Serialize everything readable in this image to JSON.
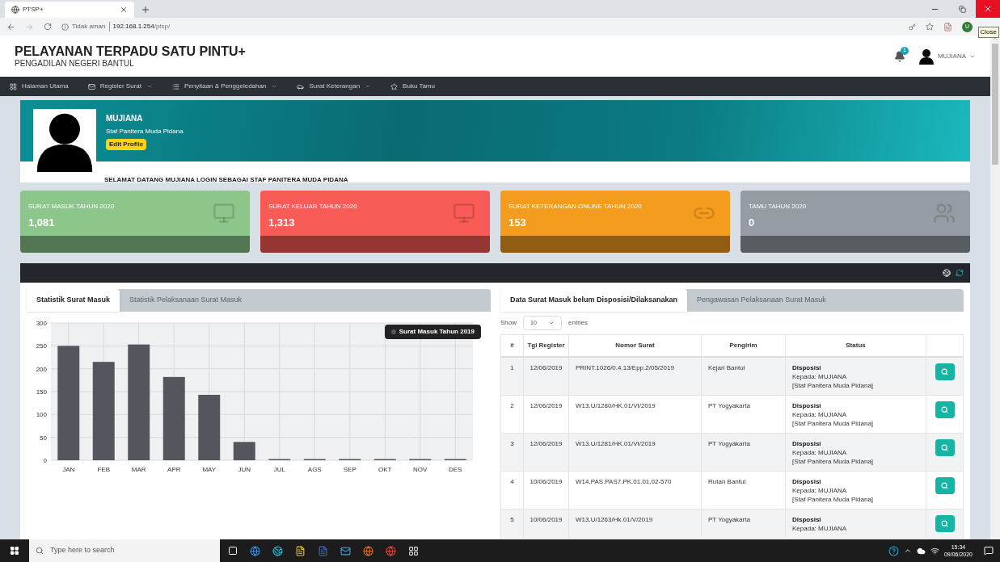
{
  "browser": {
    "tab_title": "PTSP+",
    "security": "Tidak aman",
    "url_host": "192.168.1.254",
    "url_path": "/ptsp/",
    "profile_initial": "U",
    "tooltip": "Close"
  },
  "header": {
    "title": "PELAYANAN TERPADU SATU PINTU+",
    "subtitle": "PENGADILAN NEGERI BANTUL",
    "notification_count": "1",
    "user": "MUJIANA"
  },
  "nav": [
    {
      "label": "Halaman Utama",
      "kind": "grid",
      "dropdown": false
    },
    {
      "label": "Register Surat",
      "kind": "mail",
      "dropdown": true
    },
    {
      "label": "Penyitaan & Penggeledahan",
      "kind": "list",
      "dropdown": true
    },
    {
      "label": "Surat Keterangan",
      "kind": "car",
      "dropdown": true
    },
    {
      "label": "Buku Tamu",
      "kind": "star",
      "dropdown": false
    }
  ],
  "profile": {
    "name": "MUJIANA",
    "role": "Staf Panitera Muda Pidana",
    "edit_button": "Edit Profile",
    "welcome": "SELAMAT DATANG MUJIANA LOGIN SEBAGAI STAF PANITERA MUDA PIDANA"
  },
  "stats": [
    {
      "label": "SURAT MASUK TAHUN 2020",
      "value": "1,081",
      "color": "#8cc68a",
      "kind": "monitor"
    },
    {
      "label": "SURAT KELUAR TAHUN 2020",
      "value": "1,313",
      "color": "#f95b57",
      "kind": "monitor"
    },
    {
      "label": "SURAT KETERANGAN ONLINE TAHUN 2020",
      "value": "153",
      "color": "#f39c1e",
      "kind": "link"
    },
    {
      "label": "TAMU TAHUN 2020",
      "value": "0",
      "color": "#959ca3",
      "kind": "users"
    }
  ],
  "chart_panel": {
    "tabs": [
      {
        "label": "Statistik Surat Masuk",
        "selected": true
      },
      {
        "label": "Statistik Pelaksanaan Surat Masuk",
        "selected": false
      }
    ],
    "chart_data": {
      "type": "bar",
      "categories": [
        "JAN",
        "FEB",
        "MAR",
        "APR",
        "MAY",
        "JUN",
        "JUL",
        "AGS",
        "SEP",
        "OKT",
        "NOV",
        "DES"
      ],
      "series": [
        {
          "name": "Surat Masuk Tahun 2019",
          "color": "#53565c",
          "values": [
            250,
            215,
            253,
            182,
            143,
            40,
            0,
            0,
            0,
            0,
            0,
            0
          ]
        }
      ],
      "grid": true,
      "ylim": [
        0,
        300
      ],
      "yticks": [
        0,
        50,
        100,
        150,
        200,
        250,
        300
      ]
    }
  },
  "table_panel": {
    "tabs": [
      {
        "label": "Data Surat Masuk belum Disposisi/Dilaksanakan",
        "selected": true
      },
      {
        "label": "Pengawasan Pelaksanaan Surat Masuk",
        "selected": false
      }
    ],
    "show_label": "Show",
    "page_size": "10",
    "entries_label": "entries",
    "columns": [
      "#",
      "Tgl Register",
      "Nomor Surat",
      "Pengirim",
      "Status"
    ],
    "rows": [
      {
        "no": "1",
        "date": "12/06/2019",
        "number": "PRINT.1026/0.4.13/Epp.2/05/2019",
        "sender": "Kejari Bantul",
        "status_title": "Disposisi",
        "status_lines": [
          "Kepada: MUJIANA",
          "[Staf Panitera Muda Pidana]"
        ]
      },
      {
        "no": "2",
        "date": "12/06/2019",
        "number": "W13.U/1280/HK.01/VI/2019",
        "sender": "PT Yogyakarta",
        "status_title": "Disposisi",
        "status_lines": [
          "Kepada: MUJIANA",
          "[Staf Panitera Muda Pidana]"
        ]
      },
      {
        "no": "3",
        "date": "12/06/2019",
        "number": "W13.U/1281/HK.01/VI/2019",
        "sender": "PT Yogyakarta",
        "status_title": "Disposisi",
        "status_lines": [
          "Kepada: MUJIANA",
          "[Staf Panitera Muda Pidana]"
        ]
      },
      {
        "no": "4",
        "date": "10/06/2019",
        "number": "W14.PAS.PAS7.PK.01.01.02-570",
        "sender": "Rutan Bantul",
        "status_title": "Disposisi",
        "status_lines": [
          "Kepada: MUJIANA",
          "[Staf Panitera Muda Pidana]"
        ]
      },
      {
        "no": "5",
        "date": "10/06/2019",
        "number": "W13.U/1263/Hk.01/V/2019",
        "sender": "PT Yogyakarta",
        "status_title": "Disposisi",
        "status_lines": [
          "Kepada: MUJIANA"
        ]
      }
    ]
  },
  "taskbar": {
    "search_placeholder": "Type here to search",
    "time": "15:34",
    "date": "09/06/2020"
  }
}
